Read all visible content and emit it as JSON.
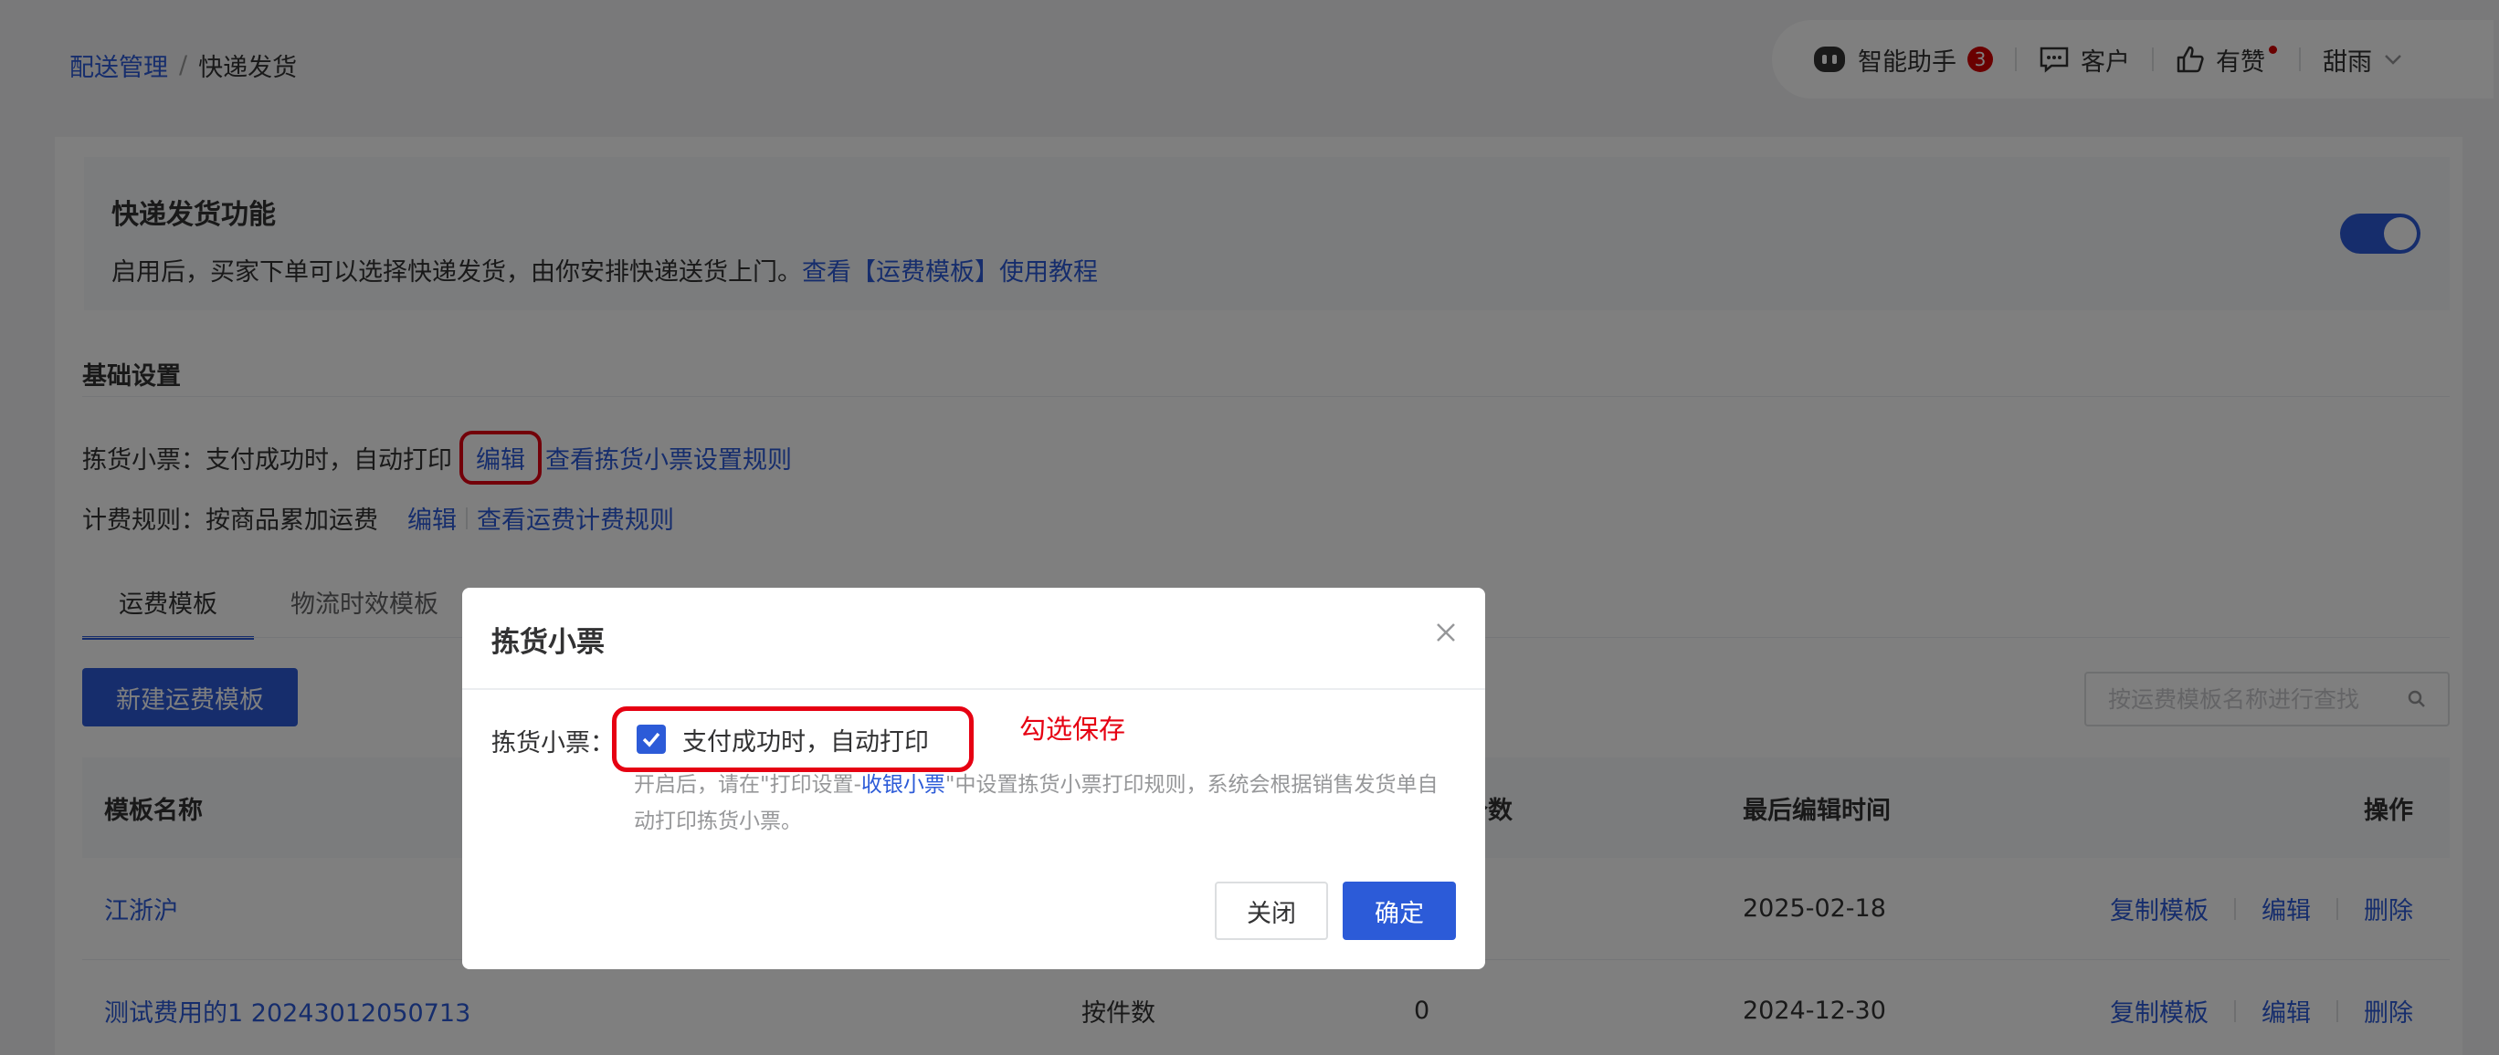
{
  "breadcrumb": {
    "parent": "配送管理",
    "separator": "/",
    "current": "快递发货"
  },
  "topbar": {
    "assistant_label": "智能助手",
    "assistant_badge": "3",
    "customer_label": "客户",
    "like_label": "有赞",
    "user_label": "甜雨"
  },
  "feature": {
    "title": "快递发货功能",
    "desc_prefix": "启用后，买家下单可以选择快递发货，由你安排快递送货上门。",
    "desc_link": "查看【运费模板】使用教程",
    "toggle_on": true
  },
  "basic": {
    "title": "基础设置",
    "ticket_label": "拣货小票：",
    "ticket_value": "支付成功时，自动打印",
    "ticket_edit": "编辑",
    "ticket_rule_link": "查看拣货小票设置规则",
    "fee_label": "计费规则：",
    "fee_value": "按商品累加运费",
    "fee_edit": "编辑",
    "fee_rule_link": "查看运费计费规则"
  },
  "tabs": [
    {
      "label": "运费模板",
      "active": true
    },
    {
      "label": "物流时效模板",
      "active": false
    }
  ],
  "toolbar": {
    "new_button": "新建运费模板",
    "search_placeholder": "按运费模板名称进行查找"
  },
  "table": {
    "headers": [
      "模板名称",
      "",
      "使用个数",
      "最后编辑时间",
      "操作"
    ],
    "rows": [
      {
        "name": "江浙沪",
        "method": "",
        "count": "",
        "updated": "2025-02-18"
      },
      {
        "name": "测试费用的1 20243012050713",
        "method": "按件数",
        "count": "0",
        "updated": "2024-12-30"
      }
    ],
    "actions": [
      "复制模板",
      "编辑",
      "删除"
    ]
  },
  "modal": {
    "title": "拣货小票",
    "label": "拣货小票：",
    "checkbox_label": "支付成功时，自动打印",
    "checked": true,
    "annotation": "勾选保存",
    "hint_prefix": "开启后，请在\"打印设置-",
    "hint_link": "收银小票",
    "hint_suffix": "\"中设置拣货小票打印规则，系统会根据销售发货单自动打印拣货小票。",
    "close_button": "关闭",
    "ok_button": "确定"
  },
  "colors": {
    "primary": "#2c5bd8",
    "highlight": "#e60012",
    "badge": "#d40000"
  }
}
